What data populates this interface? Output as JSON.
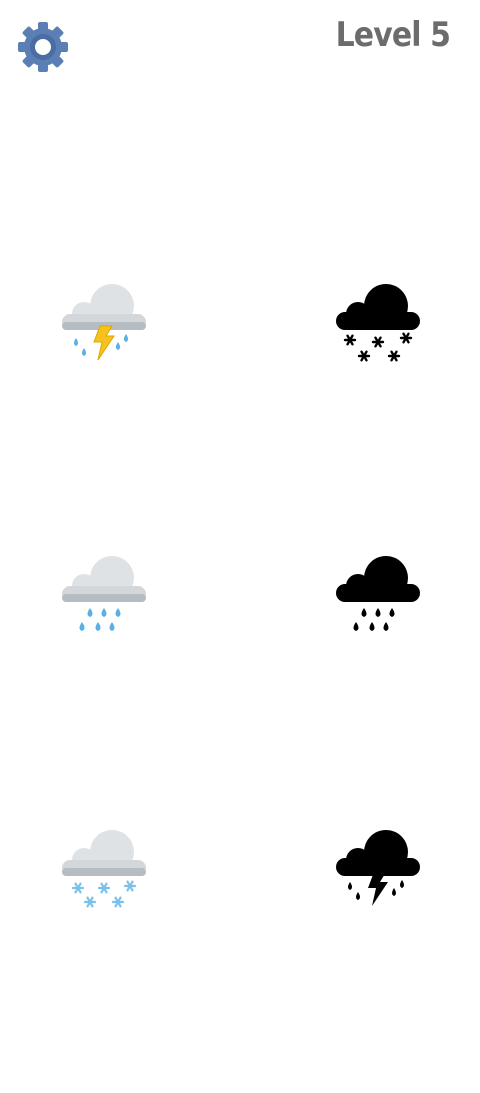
{
  "header": {
    "level_label": "Level 5",
    "settings_icon": "gear-icon"
  },
  "colors": {
    "gear": "#5b7fb4",
    "gear_hole": "#ffffff",
    "level_text": "#6c6c6c",
    "cloud": "#d4d7da",
    "cloud_shadow": "#b5bcc2",
    "rain": "#5ab0e6",
    "lightning": "#f6c21c",
    "snow": "#7cc0ec",
    "silhouette": "#000000"
  },
  "pieces": [
    {
      "icon": "cloud-with-lightning-and-rain-icon"
    },
    {
      "icon": "cloud-with-rain-icon"
    },
    {
      "icon": "cloud-with-snow-icon"
    }
  ],
  "targets": [
    {
      "icon": "cloud-with-snow-silhouette-icon"
    },
    {
      "icon": "cloud-with-rain-silhouette-icon"
    },
    {
      "icon": "cloud-with-lightning-and-rain-silhouette-icon"
    }
  ]
}
